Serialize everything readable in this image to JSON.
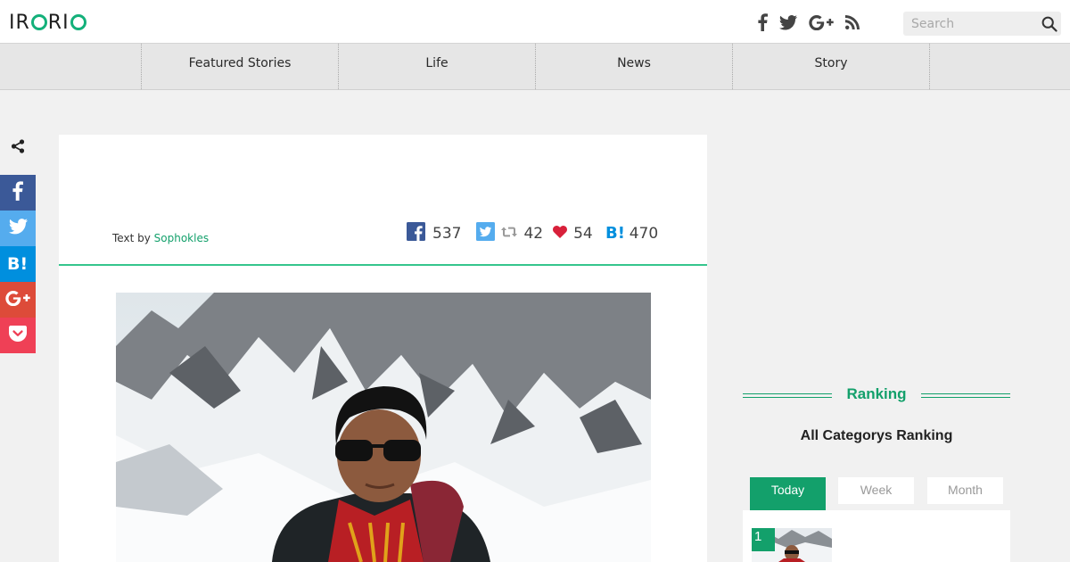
{
  "header": {
    "logo": {
      "letters": [
        "IR",
        "R",
        ""
      ]
    },
    "social": [
      "facebook-icon",
      "twitter-icon",
      "google-plus-icon",
      "rss-icon"
    ],
    "search": {
      "placeholder": "Search",
      "value": ""
    }
  },
  "nav": {
    "items": [
      {
        "label": "Featured Stories"
      },
      {
        "label": "Life"
      },
      {
        "label": "News"
      },
      {
        "label": "Story"
      }
    ]
  },
  "share_sidebar": {
    "buttons": [
      {
        "icon": "facebook-icon",
        "color": "#3b5998"
      },
      {
        "icon": "twitter-icon",
        "color": "#55acee"
      },
      {
        "icon": "hatena-bookmark-icon",
        "color": "#008fde"
      },
      {
        "icon": "google-plus-icon",
        "color": "#dd4b39"
      },
      {
        "icon": "pocket-icon",
        "color": "#ef4056"
      }
    ]
  },
  "article": {
    "byline_prefix": "Text by",
    "author": "Sophokles",
    "counts": {
      "facebook": "537",
      "retweets": "42",
      "likes": "54",
      "hatena": "470"
    }
  },
  "ranking": {
    "title": "Ranking",
    "subtitle": "All Categorys Ranking",
    "tabs": [
      {
        "label": "Today",
        "active": true
      },
      {
        "label": "Week",
        "active": false
      },
      {
        "label": "Month",
        "active": false
      }
    ],
    "items": [
      {
        "rank": "1"
      }
    ]
  },
  "colors": {
    "accent": "#13a06b",
    "facebook": "#3b5998",
    "twitter": "#55acee",
    "hatena": "#008fde",
    "googleplus": "#dd4b39",
    "pocket": "#ef4056"
  }
}
